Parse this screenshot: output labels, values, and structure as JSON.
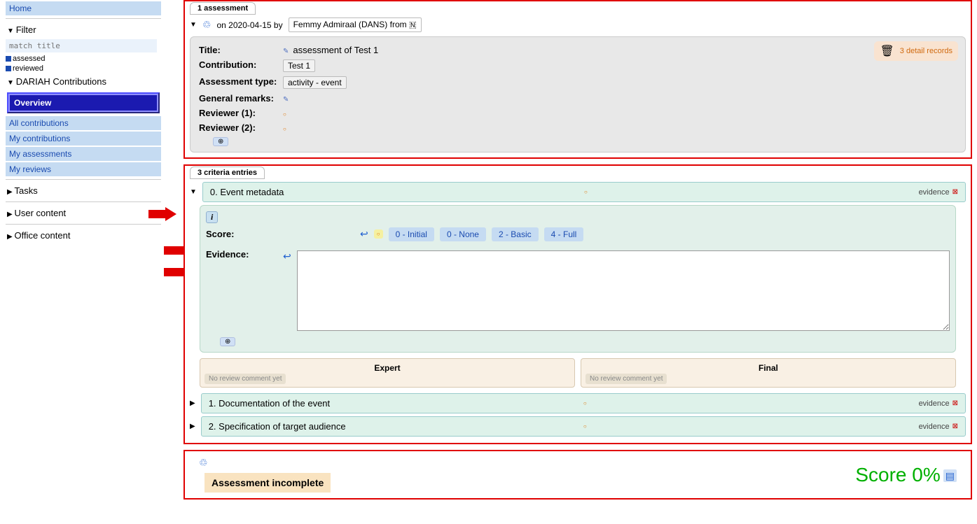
{
  "sidebar": {
    "home": "Home",
    "filter": "Filter",
    "filter_placeholder": "match title",
    "check1": "assessed",
    "check2": "reviewed",
    "dariah": "DARIAH Contributions",
    "overview": "Overview",
    "nav": [
      "All contributions",
      "My contributions",
      "My assessments",
      "My reviews"
    ],
    "tasks": "Tasks",
    "user_content": "User content",
    "office_content": "Office content"
  },
  "assessment": {
    "count_label": "1 assessment",
    "date_prefix": "on",
    "date": "2020-04-15",
    "by": "by",
    "author": "Femmy Admiraal (DANS) from",
    "flag": "🇳",
    "trash_label": "3 detail records",
    "fields": {
      "title_l": "Title:",
      "title_v": "assessment of Test 1",
      "contrib_l": "Contribution:",
      "contrib_v": "Test 1",
      "type_l": "Assessment type:",
      "type_v": "activity - event",
      "remarks_l": "General remarks:",
      "rev1_l": "Reviewer (1):",
      "rev2_l": "Reviewer (2):"
    }
  },
  "criteria": {
    "count_label": "3 criteria entries",
    "items": [
      {
        "title": "0. Event metadata",
        "evidence": "evidence"
      },
      {
        "title": "1. Documentation of the event",
        "evidence": "evidence"
      },
      {
        "title": "2. Specification of target audience",
        "evidence": "evidence"
      }
    ],
    "score_l": "Score:",
    "evidence_l": "Evidence:",
    "score_opts": [
      "0 - Initial",
      "0 - None",
      "2 - Basic",
      "4 - Full"
    ],
    "expert": "Expert",
    "final": "Final",
    "no_review": "No review comment yet"
  },
  "bottom": {
    "incomplete": "Assessment incomplete",
    "score": "Score 0%"
  }
}
